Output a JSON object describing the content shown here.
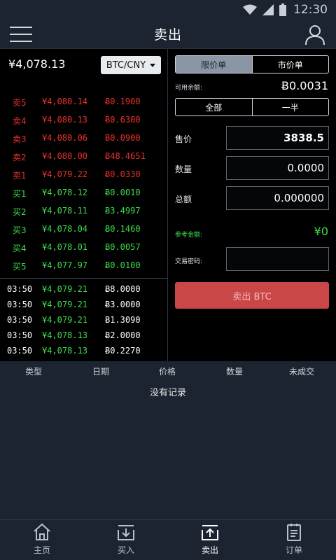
{
  "status_bar": {
    "time": "12:30"
  },
  "header": {
    "title": "卖出"
  },
  "market": {
    "last_price": "¥4,078.13",
    "pair": "BTC/CNY"
  },
  "order_book": {
    "asks": [
      {
        "label": "卖5",
        "price": "¥4,080.14",
        "amount": "Ƀ0.1900"
      },
      {
        "label": "卖4",
        "price": "¥4,080.13",
        "amount": "Ƀ0.6300"
      },
      {
        "label": "卖3",
        "price": "¥4,080.06",
        "amount": "Ƀ0.0900"
      },
      {
        "label": "卖2",
        "price": "¥4,080.00",
        "amount": "Ƀ48.4651"
      },
      {
        "label": "卖1",
        "price": "¥4,079.22",
        "amount": "Ƀ0.0330"
      }
    ],
    "bids": [
      {
        "label": "买1",
        "price": "¥4,078.12",
        "amount": "Ƀ0.0010"
      },
      {
        "label": "买2",
        "price": "¥4,078.11",
        "amount": "Ƀ3.4997"
      },
      {
        "label": "买3",
        "price": "¥4,078.04",
        "amount": "Ƀ0.1460"
      },
      {
        "label": "买4",
        "price": "¥4,078.01",
        "amount": "Ƀ0.0057"
      },
      {
        "label": "买5",
        "price": "¥4,077.97",
        "amount": "Ƀ0.0100"
      }
    ]
  },
  "trades": [
    {
      "time": "03:50",
      "price": "¥4,079.21",
      "amount": "Ƀ8.0000"
    },
    {
      "time": "03:50",
      "price": "¥4,079.21",
      "amount": "Ƀ3.0000"
    },
    {
      "time": "03:50",
      "price": "¥4,079.21",
      "amount": "Ƀ1.3090"
    },
    {
      "time": "03:50",
      "price": "¥4,078.13",
      "amount": "Ƀ2.0000"
    },
    {
      "time": "03:50",
      "price": "¥4,078.13",
      "amount": "Ƀ0.2270"
    }
  ],
  "order_form": {
    "order_types": [
      "限价单",
      "市价单"
    ],
    "active_order_type": "限价单",
    "balance_label": "可用余额:",
    "balance_value": "Ƀ0.0031",
    "quick_amounts": [
      "全部",
      "一半"
    ],
    "price_label": "售价",
    "price_value": "3838.5",
    "quantity_label": "数量",
    "quantity_value": "0.0000",
    "total_label": "总额",
    "total_value": "0.000000",
    "reference_label": "参考金额:",
    "reference_value": "¥0",
    "password_label": "交易密码:",
    "submit_label": "卖出 BTC"
  },
  "orders": {
    "columns": [
      "类型",
      "日期",
      "价格",
      "数量",
      "未成交"
    ],
    "empty_text": "没有记录"
  },
  "tab_bar": {
    "tabs": [
      {
        "label": "主页",
        "icon": "home-icon"
      },
      {
        "label": "买入",
        "icon": "download-icon"
      },
      {
        "label": "卖出",
        "icon": "upload-icon"
      },
      {
        "label": "订单",
        "icon": "clipboard-icon"
      }
    ],
    "active": "卖出"
  },
  "colors": {
    "sell": "#e8302a",
    "buy": "#3ddc4a",
    "submit": "#c94746",
    "header_bg": "#1b2430"
  }
}
